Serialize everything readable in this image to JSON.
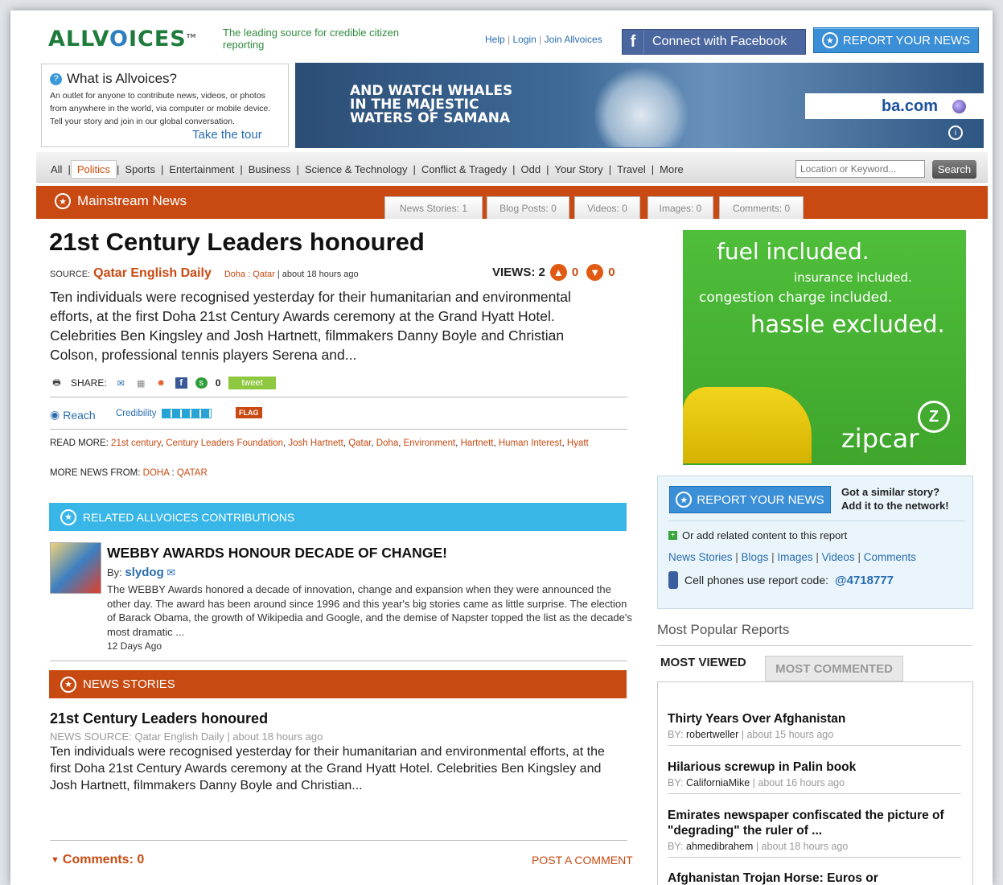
{
  "header": {
    "logo": {
      "pre": "ALLV",
      "o": "O",
      "post": "ICES",
      "tm": "TM"
    },
    "tagline": "The leading source for credible citizen reporting",
    "links": [
      "Help",
      "Login",
      "Join Allvoices"
    ],
    "facebook_label": "Connect with Facebook",
    "report_label": "REPORT YOUR NEWS"
  },
  "what_is": {
    "title": "What is Allvoices?",
    "text": "An outlet for anyone to contribute news, videos, or photos from anywhere in the world, via computer or mobile device. Tell your story and join in our global conversation.",
    "tour_link": "Take the tour"
  },
  "banner": {
    "text_lines": [
      "AND WATCH WHALES",
      "IN THE MAJESTIC",
      "WATERS OF SAMANA"
    ],
    "brand": "ba.com"
  },
  "nav": {
    "items": [
      "All",
      "Politics",
      "Sports",
      "Entertainment",
      "Business",
      "Science & Technology",
      "Conflict & Tragedy",
      "Odd",
      "Your Story",
      "Travel",
      "More"
    ],
    "active": "Politics",
    "search_placeholder": "Location or Keyword...",
    "search_label": "Search"
  },
  "section": {
    "title": "Mainstream News",
    "tabs": [
      "News Stories: 1",
      "Blog Posts: 0",
      "Videos: 0",
      "Images: 0",
      "Comments: 0"
    ]
  },
  "article": {
    "title": "21st Century Leaders honoured",
    "source_label": "SOURCE:",
    "source_name": "Qatar English Daily",
    "location": "Doha : Qatar",
    "time": "| about 18 hours ago",
    "views_label": "VIEWS: 2",
    "up_count": "0",
    "down_count": "0",
    "body": "Ten individuals were recognised yesterday for their humanitarian and environmental efforts, at the first Doha 21st Century Awards ceremony at the Grand Hyatt Hotel. Celebrities Ben Kingsley and Josh Hartnett, filmmakers Danny Boyle and Christian Colson, professional tennis players Serena and...",
    "share_label": "SHARE:",
    "share_count": "0",
    "tweet_label": "tweet",
    "reach_label": "Reach",
    "credibility_label": "Credibility",
    "flag_label": "FLAG",
    "read_more_label": "READ MORE:",
    "read_more_tags": [
      "21st century",
      "Century Leaders Foundation",
      "Josh Hartnett",
      "Qatar",
      "Doha",
      "Environment",
      "Hartnett",
      "Human Interest",
      "Hyatt"
    ],
    "more_news_label": "MORE NEWS FROM:",
    "more_news_city": "DOHA",
    "more_news_country": "QATAR"
  },
  "related": {
    "header": "RELATED ALLVOICES CONTRIBUTIONS",
    "title": "WEBBY AWARDS HONOUR DECADE OF CHANGE!",
    "by_label": "By:",
    "author": "slydog",
    "text": "The WEBBY Awards honored a decade of innovation, change and expansion when they were announced the other day. The award has been around since 1996 and this year's big stories came as little surprise. The election of Barack Obama, the growth of Wikipedia and Google, and the demise of Napster topped the list as the decade's most dramatic ...",
    "age": "12 Days Ago"
  },
  "news_stories": {
    "header": "NEWS STORIES",
    "title": "21st Century Leaders honoured",
    "source": "NEWS SOURCE: Qatar English Daily | about 18 hours ago",
    "text": "Ten individuals were recognised yesterday for their humanitarian and environmental efforts, at the first Doha 21st Century Awards ceremony at the Grand Hyatt Hotel. Celebrities Ben Kingsley and Josh Hartnett, filmmakers Danny Boyle and Christian..."
  },
  "comments": {
    "label": "Comments: 0",
    "post_label": "POST A COMMENT"
  },
  "ad": {
    "line1": "fuel included.",
    "line2": "insurance included.",
    "line3": "congestion charge included.",
    "line4": "hassle excluded.",
    "brand": "zipcar"
  },
  "report_box": {
    "button": "REPORT YOUR NEWS",
    "similar_line1": "Got a similar story?",
    "similar_line2": "Add it to the network!",
    "add_related": "Or add related content to this report",
    "links": [
      "News Stories",
      "Blogs",
      "Images",
      "Videos",
      "Comments"
    ],
    "cell_text": "Cell phones use report code:",
    "code": "@4718777"
  },
  "popular": {
    "title": "Most Popular Reports",
    "tabs": [
      "MOST VIEWED",
      "MOST COMMENTED"
    ],
    "by_label": "BY:",
    "items": [
      {
        "title": "Thirty Years Over Afghanistan",
        "author": "robertweller",
        "time": "| about 15 hours ago"
      },
      {
        "title": "Hilarious screwup in Palin book",
        "author": "CaliforniaMike",
        "time": "| about 16 hours ago"
      },
      {
        "title": "Emirates newspaper confiscated the picture of \"degrading\" the ruler of ...",
        "author": "ahmedibrahem",
        "time": "| about 18 hours ago"
      },
      {
        "title": "Afghanistan Trojan Horse: Euros or",
        "author": "",
        "time": ""
      }
    ]
  }
}
